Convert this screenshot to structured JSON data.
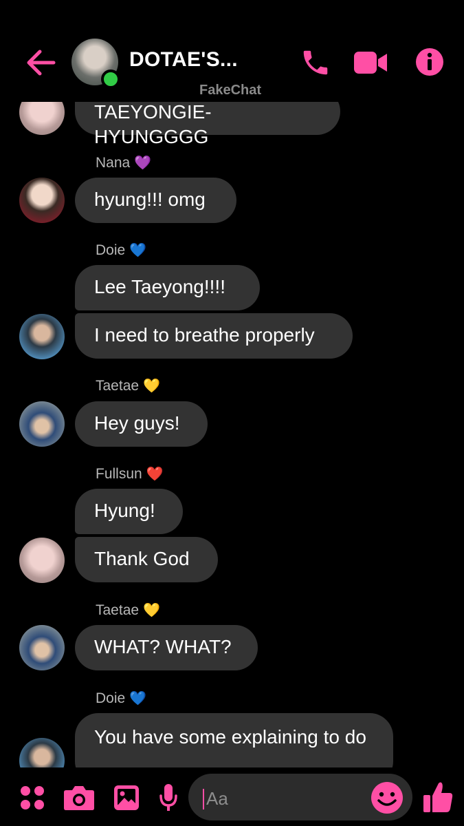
{
  "header": {
    "title": "DOTAE'S...",
    "watermark": "FakeChat",
    "icons": [
      "back-arrow-icon",
      "phone-icon",
      "video-camera-icon",
      "info-icon"
    ],
    "accent_color": "#ff4fa5"
  },
  "messages": [
    {
      "sender_label": "",
      "text": "TAEYONGIE-HYUNGGGG"
    },
    {
      "sender_label": "Nana",
      "sender_heart": "💜",
      "text": "hyung!!! omg"
    },
    {
      "sender_label": "Doie",
      "sender_heart": "💙",
      "text": "Lee Taeyong!!!!"
    },
    {
      "sender_label": "",
      "text": "I need to breathe properly"
    },
    {
      "sender_label": "Taetae",
      "sender_heart": "💛",
      "text": "Hey guys!"
    },
    {
      "sender_label": "Fullsun",
      "sender_heart": "❤️",
      "text": "Hyung!"
    },
    {
      "sender_label": "",
      "text": "Thank God"
    },
    {
      "sender_label": "Taetae",
      "sender_heart": "💛",
      "text": "WHAT? WHAT?"
    },
    {
      "sender_label": "Doie",
      "sender_heart": "💙",
      "text": "You have some explaining to do"
    }
  ],
  "composer": {
    "placeholder": "Aa",
    "icons": [
      "apps-grid-icon",
      "camera-icon",
      "image-icon",
      "microphone-icon",
      "emoji-icon",
      "thumbs-up-icon"
    ]
  },
  "colors": {
    "bubble": "#333333",
    "background": "#000000",
    "online": "#31cc46"
  }
}
